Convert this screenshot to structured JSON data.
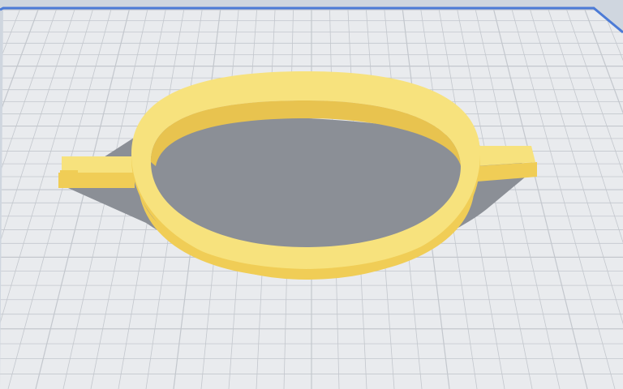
{
  "app": {
    "view": "3d-build-plate-preview"
  },
  "scene": {
    "background_color": "#cfd6df",
    "plate": {
      "fill_color": "#e9ebee",
      "grid_line_color": "#c3c7cd",
      "edge_color": "#4c7bd6"
    },
    "model": {
      "name": "",
      "shape": "ring-with-two-tabs",
      "top_color": "#f7e27d",
      "side_color": "#f0cd56",
      "inner_wall_color": "#e8c34f",
      "shadow_color": "#8b8f96"
    }
  }
}
